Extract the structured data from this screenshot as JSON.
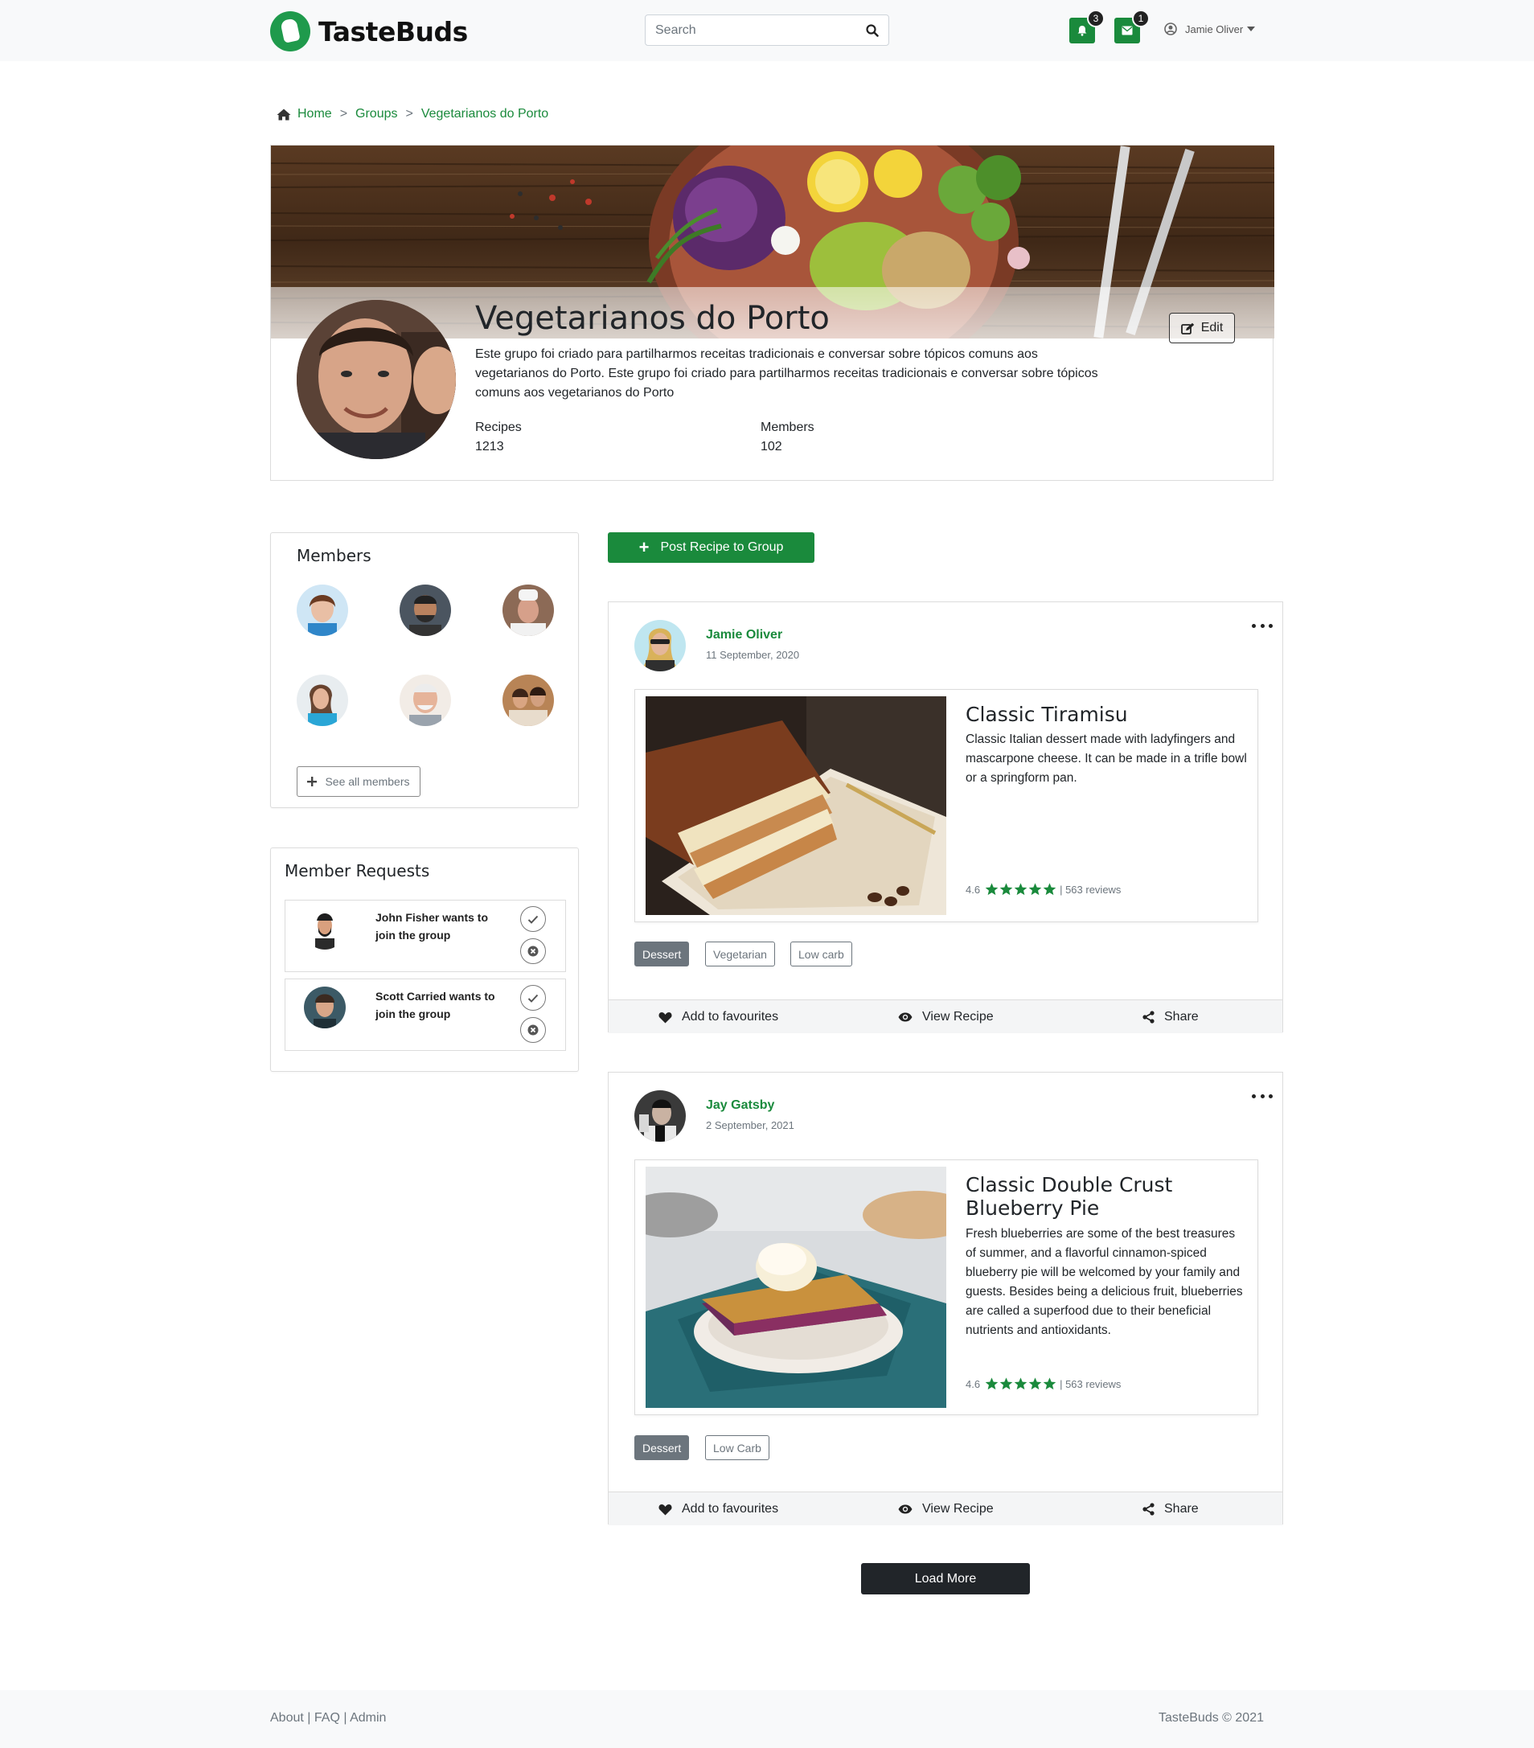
{
  "header": {
    "brand": "TasteBuds",
    "search_placeholder": "Search",
    "notifications_count": "3",
    "messages_count": "1",
    "user_name": "Jamie Oliver"
  },
  "breadcrumb": {
    "home": "Home",
    "groups": "Groups",
    "current": "Vegetarianos do Porto",
    "separator": ">"
  },
  "group": {
    "title": "Vegetarianos do Porto",
    "description": "Este grupo foi criado para partilharmos receitas tradicionais e conversar sobre tópicos comuns aos vegetarianos do Porto. Este grupo foi criado para partilharmos receitas tradicionais e conversar sobre tópicos comuns aos vegetarianos do Porto",
    "recipes_label": "Recipes",
    "recipes_count": "1213",
    "members_label": "Members",
    "members_count": "102",
    "edit_label": "Edit"
  },
  "members_panel": {
    "title": "Members",
    "see_all_label": "See all members"
  },
  "requests_panel": {
    "title": "Member Requests",
    "requests": [
      {
        "text": "John Fisher wants to join the group"
      },
      {
        "text": "Scott Carried wants to join the group"
      }
    ]
  },
  "post_button_label": "Post Recipe to Group",
  "recipes": [
    {
      "author": "Jamie Oliver",
      "date": "11 September, 2020",
      "title": "Classic Tiramisu",
      "description": "Classic Italian dessert made with ladyfingers and mascarpone cheese. It can be made in a trifle bowl or a springform pan.",
      "rating": "4.6",
      "stars": 5,
      "reviews": "| 563 reviews",
      "tags": [
        "Dessert",
        "Vegetarian",
        "Low carb"
      ]
    },
    {
      "author": "Jay Gatsby",
      "date": "2 September, 2021",
      "title": "Classic Double Crust Blueberry Pie",
      "description": "Fresh blueberries are some of the best treasures of summer, and a flavorful cinnamon-spiced blueberry pie will be welcomed by your family and guests. Besides being a delicious fruit, blueberries are called a superfood due to their beneficial nutrients and antioxidants.",
      "rating": "4.6",
      "stars": 5,
      "reviews": "| 563 reviews",
      "tags": [
        "Dessert",
        "Low Carb"
      ]
    }
  ],
  "actions": {
    "favourite": "Add to favourites",
    "view": "View Recipe",
    "share": "Share"
  },
  "load_more_label": "Load More",
  "footer": {
    "about": "About",
    "faq": "FAQ",
    "admin": "Admin",
    "divider": "|",
    "copyright": "TasteBuds © 2021"
  },
  "colors": {
    "brand_green": "#1a8a3c",
    "dark_button": "#212529",
    "tag_gray": "#6c757d"
  }
}
